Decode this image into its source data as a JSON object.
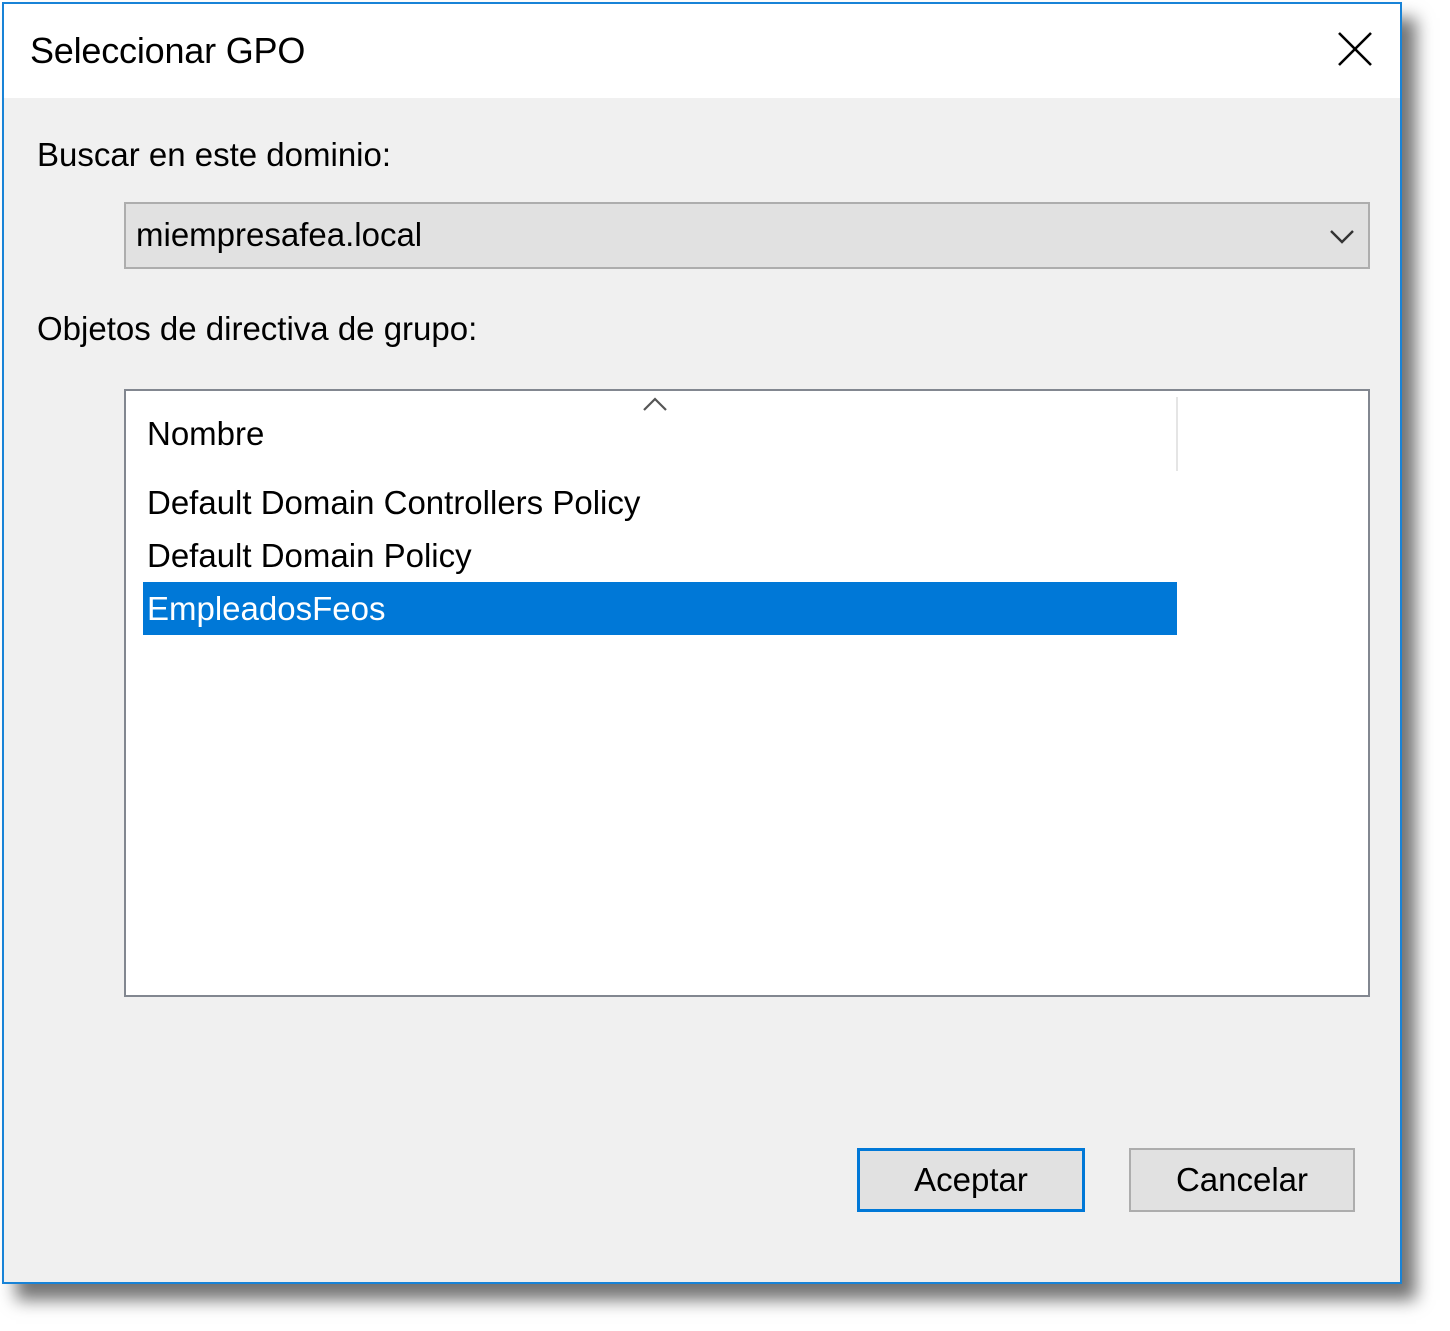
{
  "window": {
    "title": "Seleccionar GPO",
    "close_icon": "close-icon"
  },
  "domain": {
    "label": "Buscar en este dominio:",
    "selected_value": "miempresafea.local",
    "dropdown_icon": "chevron-down-icon"
  },
  "gpo_list": {
    "label": "Objetos de directiva de grupo:",
    "column_header": "Nombre",
    "sort_icon": "sort-ascending-icon",
    "items": [
      {
        "name": "Default Domain Controllers Policy",
        "selected": false
      },
      {
        "name": "Default Domain Policy",
        "selected": false
      },
      {
        "name": "EmpleadosFeos",
        "selected": true
      }
    ]
  },
  "buttons": {
    "ok_label": "Aceptar",
    "cancel_label": "Cancelar"
  },
  "colors": {
    "accent": "#0078d7",
    "window_border": "#1883d7",
    "dialog_background": "#f0f0f0",
    "selection_background": "#0078d7",
    "selection_text": "#ffffff"
  }
}
